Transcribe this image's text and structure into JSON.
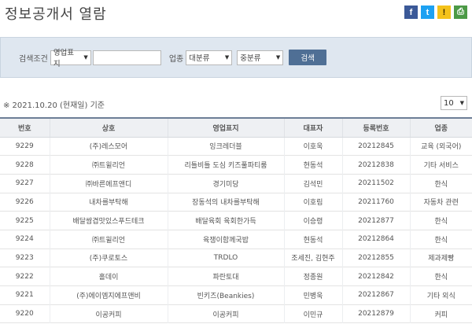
{
  "page": {
    "title": "정보공개서 열람"
  },
  "share": {
    "facebook": "f",
    "twitter": "t",
    "kakaostory": "!",
    "print": "⎙"
  },
  "search": {
    "condition_label": "검색조건",
    "condition_selected": "영업표지",
    "keyword_value": "",
    "industry_label": "업종",
    "major_selected": "대분류",
    "minor_selected": "중분류",
    "search_button": "검색"
  },
  "list": {
    "date_note": "※ 2021.10.20 (현재일) 기준",
    "page_size": "10",
    "columns": [
      "번호",
      "상호",
      "영업표지",
      "대표자",
      "등록번호",
      "업종"
    ],
    "rows": [
      [
        "9229",
        "(주)레스모어",
        "잉크레더블",
        "이호욱",
        "20212845",
        "교육 (외국어)"
      ],
      [
        "9228",
        "㈜트윌리언",
        "리틀비틀 도심 키즈풀파티룸",
        "현동석",
        "20212838",
        "기타 서비스"
      ],
      [
        "9227",
        "㈜바른에프앤디",
        "경기미당",
        "김석민",
        "20211502",
        "한식"
      ],
      [
        "9226",
        "내차를부탁해",
        "장동석의 내차를부탁해",
        "이호림",
        "20211760",
        "자동차 관련"
      ],
      [
        "9225",
        "배달쌈겹맛있스푸드테크",
        "배달육회 육회한가득",
        "이승령",
        "20212877",
        "한식"
      ],
      [
        "9224",
        "㈜트윌리언",
        "육쟁이함께국밥",
        "현동석",
        "20212864",
        "한식"
      ],
      [
        "9223",
        "(주)쿠로토스",
        "TRDLO",
        "조세진, 김현주",
        "20212855",
        "제과제빵"
      ],
      [
        "9222",
        "홀데이",
        "파란토대",
        "정종원",
        "20212842",
        "한식"
      ],
      [
        "9221",
        "(주)에이엠지에프앤비",
        "빈키즈(Beankies)",
        "민병욱",
        "20212867",
        "기타 외식"
      ],
      [
        "9220",
        "이공커피",
        "이공커피",
        "이민규",
        "20212879",
        "커피"
      ]
    ]
  }
}
